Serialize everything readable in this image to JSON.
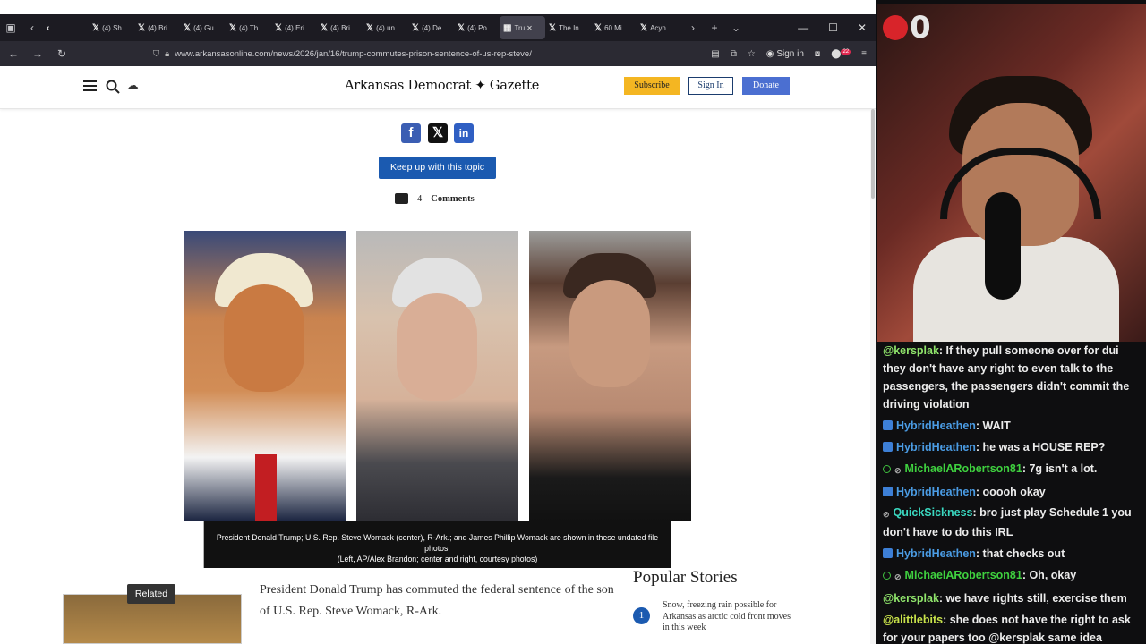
{
  "browser": {
    "tabs": [
      {
        "label": "",
        "icon": "back-chevron"
      },
      {
        "label": "(4) Sh",
        "icon": "x-logo"
      },
      {
        "label": "(4) Bri",
        "icon": "x-logo"
      },
      {
        "label": "(4) Gu",
        "icon": "x-logo"
      },
      {
        "label": "(4) Th",
        "icon": "x-logo"
      },
      {
        "label": "(4) Eri",
        "icon": "x-logo"
      },
      {
        "label": "(4) Bri",
        "icon": "x-logo"
      },
      {
        "label": "(4) un",
        "icon": "x-logo"
      },
      {
        "label": "(4) De",
        "icon": "x-logo"
      },
      {
        "label": "(4) Po",
        "icon": "x-logo"
      },
      {
        "label": "Tru",
        "icon": "site-icon",
        "active": true
      },
      {
        "label": "The In",
        "icon": "x-logo"
      },
      {
        "label": "60 Mi",
        "icon": "x-logo"
      },
      {
        "label": "Acyn",
        "icon": "x-logo"
      }
    ],
    "url": "www.arkansasonline.com/news/2026/jan/16/trump-commutes-prison-sentence-of-us-rep-steve/",
    "sign_in": "Sign in",
    "ext_badge": "22"
  },
  "site": {
    "logo": "Arkansas Democrat ✦ Gazette",
    "subscribe": "Subscribe",
    "sign_in": "Sign In",
    "donate": "Donate"
  },
  "article": {
    "keep_up": "Keep up with this topic",
    "comments_count": "4",
    "comments_label": "Comments",
    "caption_line1": "President Donald Trump; U.S. Rep. Steve Womack (center), R-Ark.; and James Phillip Womack are shown in these undated file photos.",
    "caption_line2": "(Left, AP/Alex Brandon; center and right, courtesy photos)",
    "related": "Related",
    "lede": "President Donald Trump has commuted the federal sentence of the son of U.S. Rep. Steve Womack, R-Ark."
  },
  "popular": {
    "title": "Popular Stories",
    "items": [
      {
        "num": "1",
        "text": "Snow, freezing rain possible for Arkansas as arctic cold front moves in this week"
      }
    ]
  },
  "stream": {
    "counter": "0",
    "chat": [
      {
        "badges": [],
        "user": "@kersplak",
        "user_color": "#8fe36b",
        "text": ": If they pull someone over for dui they don't have any right to even talk to the passengers, the passengers didn't commit the driving violation"
      },
      {
        "badges": [
          "mod"
        ],
        "user": "HybridHeathen",
        "user_color": "#4a9be3",
        "text": ": WAIT"
      },
      {
        "badges": [
          "mod"
        ],
        "user": "HybridHeathen",
        "user_color": "#4a9be3",
        "text": ": he was a HOUSE REP?"
      },
      {
        "badges": [
          "sub",
          "mute"
        ],
        "user": "MichaelARobertson81",
        "user_color": "#3fd13f",
        "text": ": 7g isn't a lot."
      },
      {
        "badges": [
          "mod"
        ],
        "user": "HybridHeathen",
        "user_color": "#4a9be3",
        "text": ": ooooh okay"
      },
      {
        "badges": [
          "mute"
        ],
        "user": "QuickSickness",
        "user_color": "#3ad8c0",
        "text": ": bro just play Schedule 1 you don't have to do this IRL"
      },
      {
        "badges": [
          "mod"
        ],
        "user": "HybridHeathen",
        "user_color": "#4a9be3",
        "text": ": that checks out"
      },
      {
        "badges": [
          "sub",
          "mute"
        ],
        "user": "MichaelARobertson81",
        "user_color": "#3fd13f",
        "text": ": Oh, okay"
      },
      {
        "badges": [],
        "user": "@kersplak",
        "user_color": "#8fe36b",
        "text": ": we have rights still, exercise them"
      },
      {
        "badges": [],
        "user": "@alittlebits",
        "user_color": "#c9e34a",
        "text": ": she does not have the right to ask for your papers too @kersplak same idea"
      }
    ]
  }
}
